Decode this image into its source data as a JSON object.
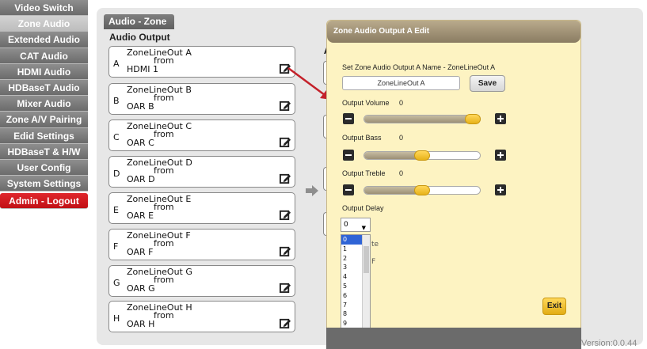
{
  "sidebar": {
    "items": [
      {
        "label": "Video Switch"
      },
      {
        "label": "Zone Audio"
      },
      {
        "label": "Extended Audio"
      },
      {
        "label": "CAT Audio"
      },
      {
        "label": "HDMI Audio"
      },
      {
        "label": "HDBaseT Audio"
      },
      {
        "label": "Mixer Audio"
      },
      {
        "label": "Zone A/V Pairing"
      },
      {
        "label": "Edid Settings"
      },
      {
        "label": "HDBaseT & H/W"
      },
      {
        "label": "User Config"
      },
      {
        "label": "System Settings"
      },
      {
        "label": "Admin - Logout"
      }
    ],
    "active_index": 1
  },
  "page": {
    "tab_title": "Audio - Zone",
    "section_title": "Audio Output",
    "right_section_letter": "A"
  },
  "outputs": [
    {
      "letter": "A",
      "name": "ZoneLineOut A",
      "from": "from",
      "source": "HDMI 1"
    },
    {
      "letter": "B",
      "name": "ZoneLineOut B",
      "from": "from",
      "source": "OAR B"
    },
    {
      "letter": "C",
      "name": "ZoneLineOut C",
      "from": "from",
      "source": "OAR C"
    },
    {
      "letter": "D",
      "name": "ZoneLineOut D",
      "from": "from",
      "source": "OAR D"
    },
    {
      "letter": "E",
      "name": "ZoneLineOut E",
      "from": "from",
      "source": "OAR E"
    },
    {
      "letter": "F",
      "name": "ZoneLineOut F",
      "from": "from",
      "source": "OAR F"
    },
    {
      "letter": "G",
      "name": "ZoneLineOut G",
      "from": "from",
      "source": "OAR G"
    },
    {
      "letter": "H",
      "name": "ZoneLineOut H",
      "from": "from",
      "source": "OAR H"
    }
  ],
  "dialog": {
    "title": "Zone Audio Output A Edit",
    "name_label": "Set Zone Audio Output A Name - ZoneLineOut A",
    "name_value": "ZoneLineOut A",
    "save_label": "Save",
    "volume_label": "Output Volume",
    "volume_value": "0",
    "volume_level": 1.0,
    "bass_label": "Output Bass",
    "bass_value": "0",
    "bass_level": 0.5,
    "treble_label": "Output Treble",
    "treble_value": "0",
    "treble_level": 0.5,
    "delay_label": "Output Delay",
    "delay_value": "0",
    "delay_options": [
      "0",
      "1",
      "2",
      "3",
      "4",
      "5",
      "6",
      "7",
      "8",
      "9"
    ],
    "partial_label": "te",
    "partial_label_2": "F",
    "exit_label": "Exit"
  },
  "colors": {
    "sidebar_bg": "#7d7d7d",
    "sidebar_active": "#c8c8c8",
    "logout_bg": "#d81b20",
    "dialog_bg": "#fdf3c2",
    "knob": "#f2c230",
    "arrow_red": "#c4212a"
  },
  "footer": {
    "version": "Version:0.0.44"
  }
}
